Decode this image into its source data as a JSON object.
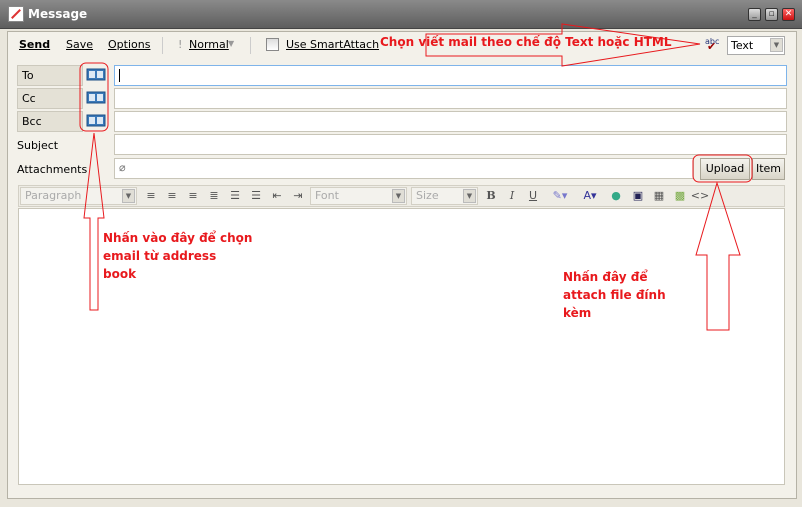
{
  "window": {
    "title": "Message",
    "icon": "compose-icon"
  },
  "toolbar": {
    "send": "Send",
    "save": "Save",
    "options": "Options",
    "priority": "Normal",
    "smartattach": "Use SmartAttach",
    "format_value": "Text"
  },
  "fields": {
    "to": "To",
    "cc": "Cc",
    "bcc": "Bcc",
    "subject": "Subject",
    "attachments": "Attachments",
    "to_value": "",
    "cc_value": "",
    "bcc_value": "",
    "subject_value": ""
  },
  "buttons": {
    "upload": "Upload",
    "item": "Item"
  },
  "editor_toolbar": {
    "paragraph": "Paragraph",
    "font": "Font",
    "size": "Size",
    "bold": "B",
    "italic": "I",
    "underline": "U",
    "source": "<>"
  },
  "annotations": {
    "format": "Chọn viết mail theo chế độ Text hoặc HTML",
    "address_book": "Nhấn vào đây để chọn email từ address book",
    "attach": "Nhấn đây để attach file đính kèm"
  },
  "colors": {
    "annotation": "#e8191d"
  }
}
